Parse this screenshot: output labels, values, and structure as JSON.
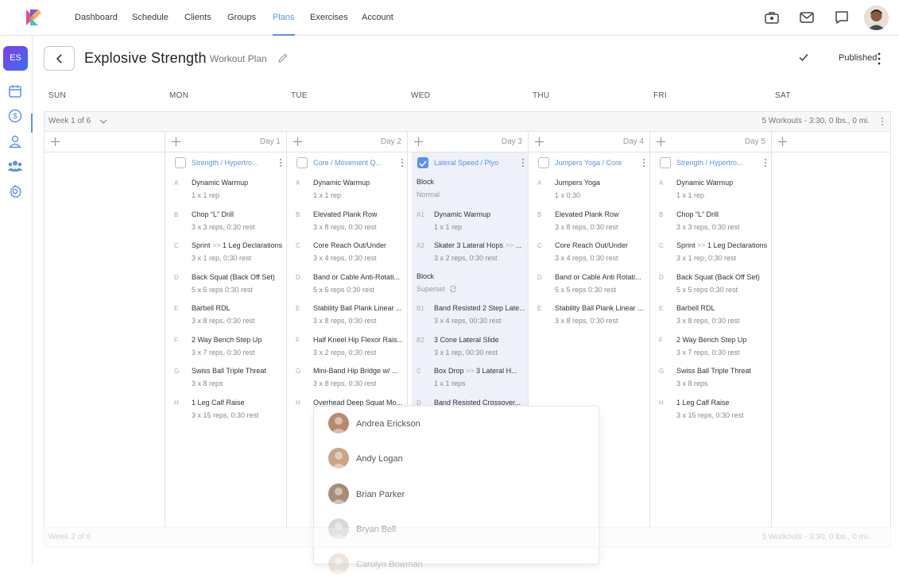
{
  "nav": {
    "items": [
      {
        "label": "Dashboard"
      },
      {
        "label": "Schedule"
      },
      {
        "label": "Clients"
      },
      {
        "label": "Groups"
      },
      {
        "label": "Plans",
        "active": true
      },
      {
        "label": "Exercises"
      },
      {
        "label": "Account"
      }
    ],
    "icons": [
      "briefcase-icon",
      "mail-icon",
      "chat-icon",
      "user-avatar"
    ]
  },
  "sidebar": {
    "badge": "ES",
    "icons": [
      "calendar-icon",
      "dollar-icon",
      "person-icon",
      "group-icon",
      "settings-icon"
    ]
  },
  "header": {
    "title": "Explosive Strength",
    "subtitle": "Workout Plan",
    "status": "Published"
  },
  "days": [
    "SUN",
    "MON",
    "TUE",
    "WED",
    "THU",
    "FRI",
    "SAT"
  ],
  "week": {
    "label": "Week 1 of 6",
    "stats": "5 Workouts - 3:30, 0 lbs., 0 mi."
  },
  "week2": {
    "label": "Week 2 of 6",
    "stats": "5 Workouts - 3:30, 0 lbs., 0 mi."
  },
  "columns": [
    {
      "day_label": ""
    },
    {
      "day_label": "Day 1",
      "workout": "Strength / Hypertro...",
      "checked": false,
      "exercises": [
        {
          "letter": "A",
          "name": "Dynamic Warmup",
          "detail": "1 x 1 rep"
        },
        {
          "letter": "B",
          "name": "Chop “L” Drill",
          "detail": "3 x 3 reps,  0:30 rest"
        },
        {
          "letter": "C",
          "name": "Sprint",
          "name2": "1 Leg Declarations",
          "detail": "3 x 1 rep,  0:30 rest"
        },
        {
          "letter": "D",
          "name": "Back Squat (Back Off Set)",
          "detail": "5 x 5 reps  0:30 rest"
        },
        {
          "letter": "E",
          "name": "Barbell RDL",
          "detail": "3 x 8 reps,  0:30 rest"
        },
        {
          "letter": "F",
          "name": "2 Way Bench Step Up",
          "detail": "3 x 7 reps,  0:30 rest"
        },
        {
          "letter": "G",
          "name": "Swiss Ball Triple Threat",
          "detail": "3 x 8 reps"
        },
        {
          "letter": "H",
          "name": "1 Leg Calf Raise",
          "detail": "3 x 15 reps,  0:30 rest"
        }
      ]
    },
    {
      "day_label": "Day 2",
      "workout": "Core / Movement Q...",
      "checked": false,
      "exercises": [
        {
          "letter": "A",
          "name": "Dynamic Warmup",
          "detail": "1 x 1 rep"
        },
        {
          "letter": "B",
          "name": "Elevated Plank Row",
          "detail": "3 x 8 reps,  0:30 rest"
        },
        {
          "letter": "C",
          "name": "Core Reach Out/Under",
          "detail": "3 x 4 reps,  0:30 rest"
        },
        {
          "letter": "D",
          "name": "Band or Cable Anti-Rotati...",
          "detail": "5 x 5 reps  0:30 rest"
        },
        {
          "letter": "E",
          "name": "Stability Ball Plank Linear ...",
          "detail": "3 x 8 reps,  0:30 rest"
        },
        {
          "letter": "F",
          "name": "Half Kneel Hip Flexor Rais...",
          "detail": "3 x 2 reps,  0:30 rest"
        },
        {
          "letter": "G",
          "name": "Mini-Band Hip Bridge w/ ...",
          "detail": "3 x 8 reps,  0:30 rest"
        },
        {
          "letter": "H",
          "name": "Overhead Deep Squat Mo...",
          "detail": ""
        }
      ]
    },
    {
      "day_label": "Day 3",
      "workout": "Lateral Speed / Plyo",
      "checked": true,
      "blocks": [
        {
          "name": "Block",
          "type": "Normal"
        },
        {
          "name": "Block",
          "type": "Superset"
        }
      ],
      "exercises": [
        {
          "letter": "A1",
          "name": "Dynamic Warmup",
          "detail": "1 x 1 rep"
        },
        {
          "letter": "A2",
          "name": "Skater 3 Lateral Hops",
          "name2": "...",
          "detail": "3 x 2 reps,  0:30 rest"
        },
        {
          "letter": "B1",
          "name": "Band Resisted 2 Step Late...",
          "detail": "3 x 4 reps,  00:30 rest"
        },
        {
          "letter": "B2",
          "name": "3 Cone Lateral Slide",
          "detail": "3 x 1 rep,  00:30 rest"
        },
        {
          "letter": "C",
          "name": "Box Drop",
          "name2": "3 Lateral H...",
          "detail": "1 x 1 reps"
        },
        {
          "letter": "D",
          "name": "Band Resisted Crossover...",
          "detail": ""
        }
      ]
    },
    {
      "day_label": "Day 4",
      "workout": "Jumpers Yoga / Core",
      "checked": false,
      "exercises": [
        {
          "letter": "A",
          "name": "Jumpers Yoga",
          "detail": "1 x  0:30"
        },
        {
          "letter": "B",
          "name": "Elevated Plank Row",
          "detail": "3 x 8 reps,  0:30 rest"
        },
        {
          "letter": "C",
          "name": "Core Reach Out/Under",
          "detail": "3 x 4 reps,  0:30 rest"
        },
        {
          "letter": "D",
          "name": "Band or Cable Anti Rotati...",
          "detail": "5 x 5 reps  0:30 rest"
        },
        {
          "letter": "E",
          "name": "Stability Ball Plank Linear ...",
          "detail": "3 x 8 reps,  0:30 rest"
        }
      ]
    },
    {
      "day_label": "Day 5",
      "workout": "Strength / Hypertro...",
      "checked": false,
      "exercises": [
        {
          "letter": "A",
          "name": "Dynamic Warmup",
          "detail": "1 x 1 rep"
        },
        {
          "letter": "B",
          "name": "Chop “L” Drill",
          "detail": "3 x 3 reps,  0:30 rest"
        },
        {
          "letter": "C",
          "name": "Sprint",
          "name2": "1 Leg Declarations",
          "detail": "3 x 1 rep,  0:30 rest"
        },
        {
          "letter": "D",
          "name": "Back Squat (Back Off Set)",
          "detail": "5 x 5 reps  0:30 rest"
        },
        {
          "letter": "E",
          "name": "Barbell RDL",
          "detail": "3 x 8 reps,  0:30 rest"
        },
        {
          "letter": "F",
          "name": "2 Way Bench Step Up",
          "detail": "3 x 7 reps,  0:30 rest"
        },
        {
          "letter": "G",
          "name": "Swiss Ball Triple Threat",
          "detail": "3 x 8 reps"
        },
        {
          "letter": "H",
          "name": "1 Leg Calf Raise",
          "detail": "3 x 15 reps,  0:30 rest"
        }
      ]
    },
    {
      "day_label": ""
    }
  ],
  "dropdown": {
    "people": [
      {
        "name": "Andrea Erickson",
        "color": "#b98a6a"
      },
      {
        "name": "Andy Logan",
        "color": "#c9a487"
      },
      {
        "name": "Brian Parker",
        "color": "#a98c73"
      },
      {
        "name": "Bryan Bell",
        "color": "#c7c7c7"
      },
      {
        "name": "Carolyn Bowman",
        "color": "#c9b3a0"
      }
    ]
  },
  "colors": {
    "accent": "#5b8ff5",
    "selected_card": "#eef1fa"
  }
}
